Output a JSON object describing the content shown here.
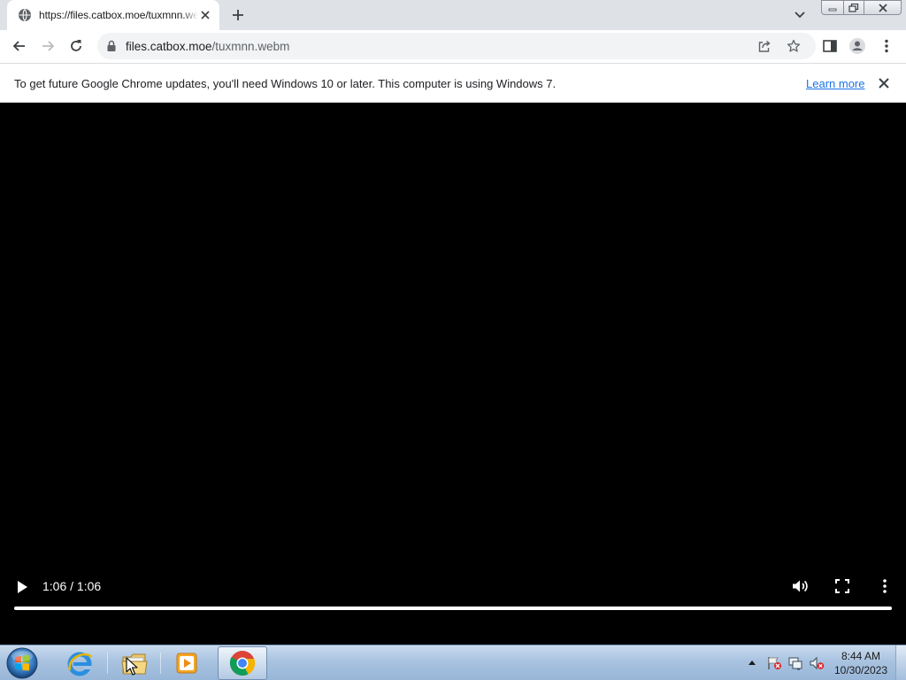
{
  "browser": {
    "tab": {
      "title": "https://files.catbox.moe/tuxmnn.webm",
      "favicon": "globe-icon",
      "close_icon": "close-icon"
    },
    "new_tab_icon": "plus-icon",
    "tab_search_icon": "chevron-down-icon",
    "window_controls": [
      "minimize-icon",
      "restore-icon",
      "close-icon"
    ],
    "toolbar": {
      "back_icon": "back-arrow-icon",
      "forward_icon": "forward-arrow-icon",
      "reload_icon": "reload-icon",
      "url_host": "files.catbox.moe",
      "url_path": "/tuxmnn.webm",
      "lock_icon": "lock-icon",
      "share_icon": "share-icon",
      "bookmark_icon": "star-icon",
      "side_panel_icon": "side-panel-icon",
      "profile_icon": "profile-icon",
      "menu_icon": "kebab-menu-icon"
    },
    "infobar": {
      "message": "To get future Google Chrome updates, you'll need Windows 10 or later. This computer is using Windows 7.",
      "link": "Learn more"
    }
  },
  "video_player": {
    "time_display": "1:06 / 1:06",
    "progress": 1.0,
    "icons": [
      "play-icon",
      "volume-icon",
      "fullscreen-icon",
      "more-options-icon"
    ]
  },
  "taskbar": {
    "apps": [
      "start-orb",
      "internet-explorer",
      "windows-explorer",
      "media-player",
      "google-chrome"
    ],
    "active_app": "google-chrome",
    "clock": {
      "time": "8:44 AM",
      "date": "10/30/2023"
    }
  },
  "colors": {
    "tabstrip_bg": "#dee1e6",
    "omnibox_bg": "#f1f3f4",
    "link": "#1a73e8",
    "video_bg": "#000000",
    "taskbar": "#a9c3e0"
  }
}
